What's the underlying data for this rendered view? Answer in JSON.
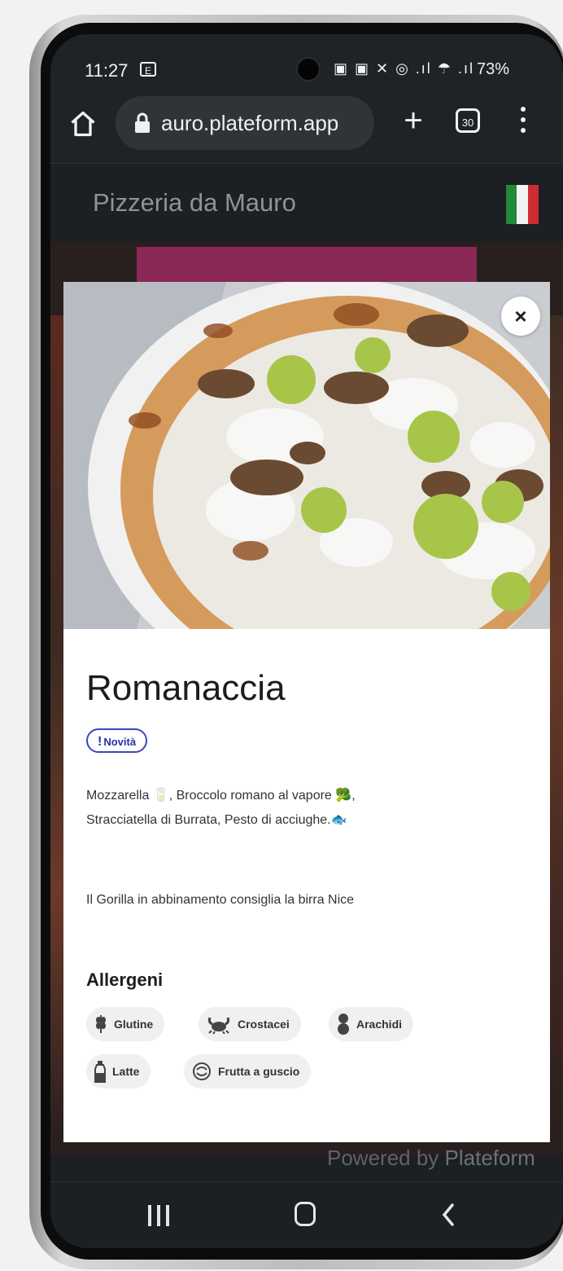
{
  "status_bar": {
    "time": "11:27",
    "badge": "E",
    "icons": "▣ ▣ ✕ ◎ .ıl ☂ .ıl",
    "battery": "73%"
  },
  "browser": {
    "url": "auro.plateform.app",
    "tab_count": "30"
  },
  "site": {
    "title": "Pizzeria da Mauro",
    "flag_colors": [
      "#1f8a3a",
      "#f3f3f3",
      "#cf2b34"
    ]
  },
  "modal": {
    "close_label": "×",
    "title": "Romanaccia",
    "badge_mark": "!",
    "badge_label": "Novità",
    "description_line1": "Mozzarella 🥛, Broccolo romano al vapore 🥦,",
    "description_line2": "Stracciatella di Burrata, Pesto di acciughe.🐟",
    "pairing": "Il Gorilla in abbinamento consiglia la birra Nice",
    "allergens_title": "Allergeni",
    "allergens": [
      {
        "label": "Glutine",
        "icon": "wheat-icon"
      },
      {
        "label": "Crostacei",
        "icon": "crab-icon"
      },
      {
        "label": "Arachidi",
        "icon": "peanut-icon"
      },
      {
        "label": "Latte",
        "icon": "milk-bottle-icon"
      },
      {
        "label": "Frutta a guscio",
        "icon": "nut-icon"
      }
    ]
  },
  "footer": {
    "powered_prefix": "Powered by ",
    "powered_brand": "Plateform"
  },
  "colors": {
    "accent_banner": "#8a2856",
    "badge_blue": "#2430a8"
  }
}
